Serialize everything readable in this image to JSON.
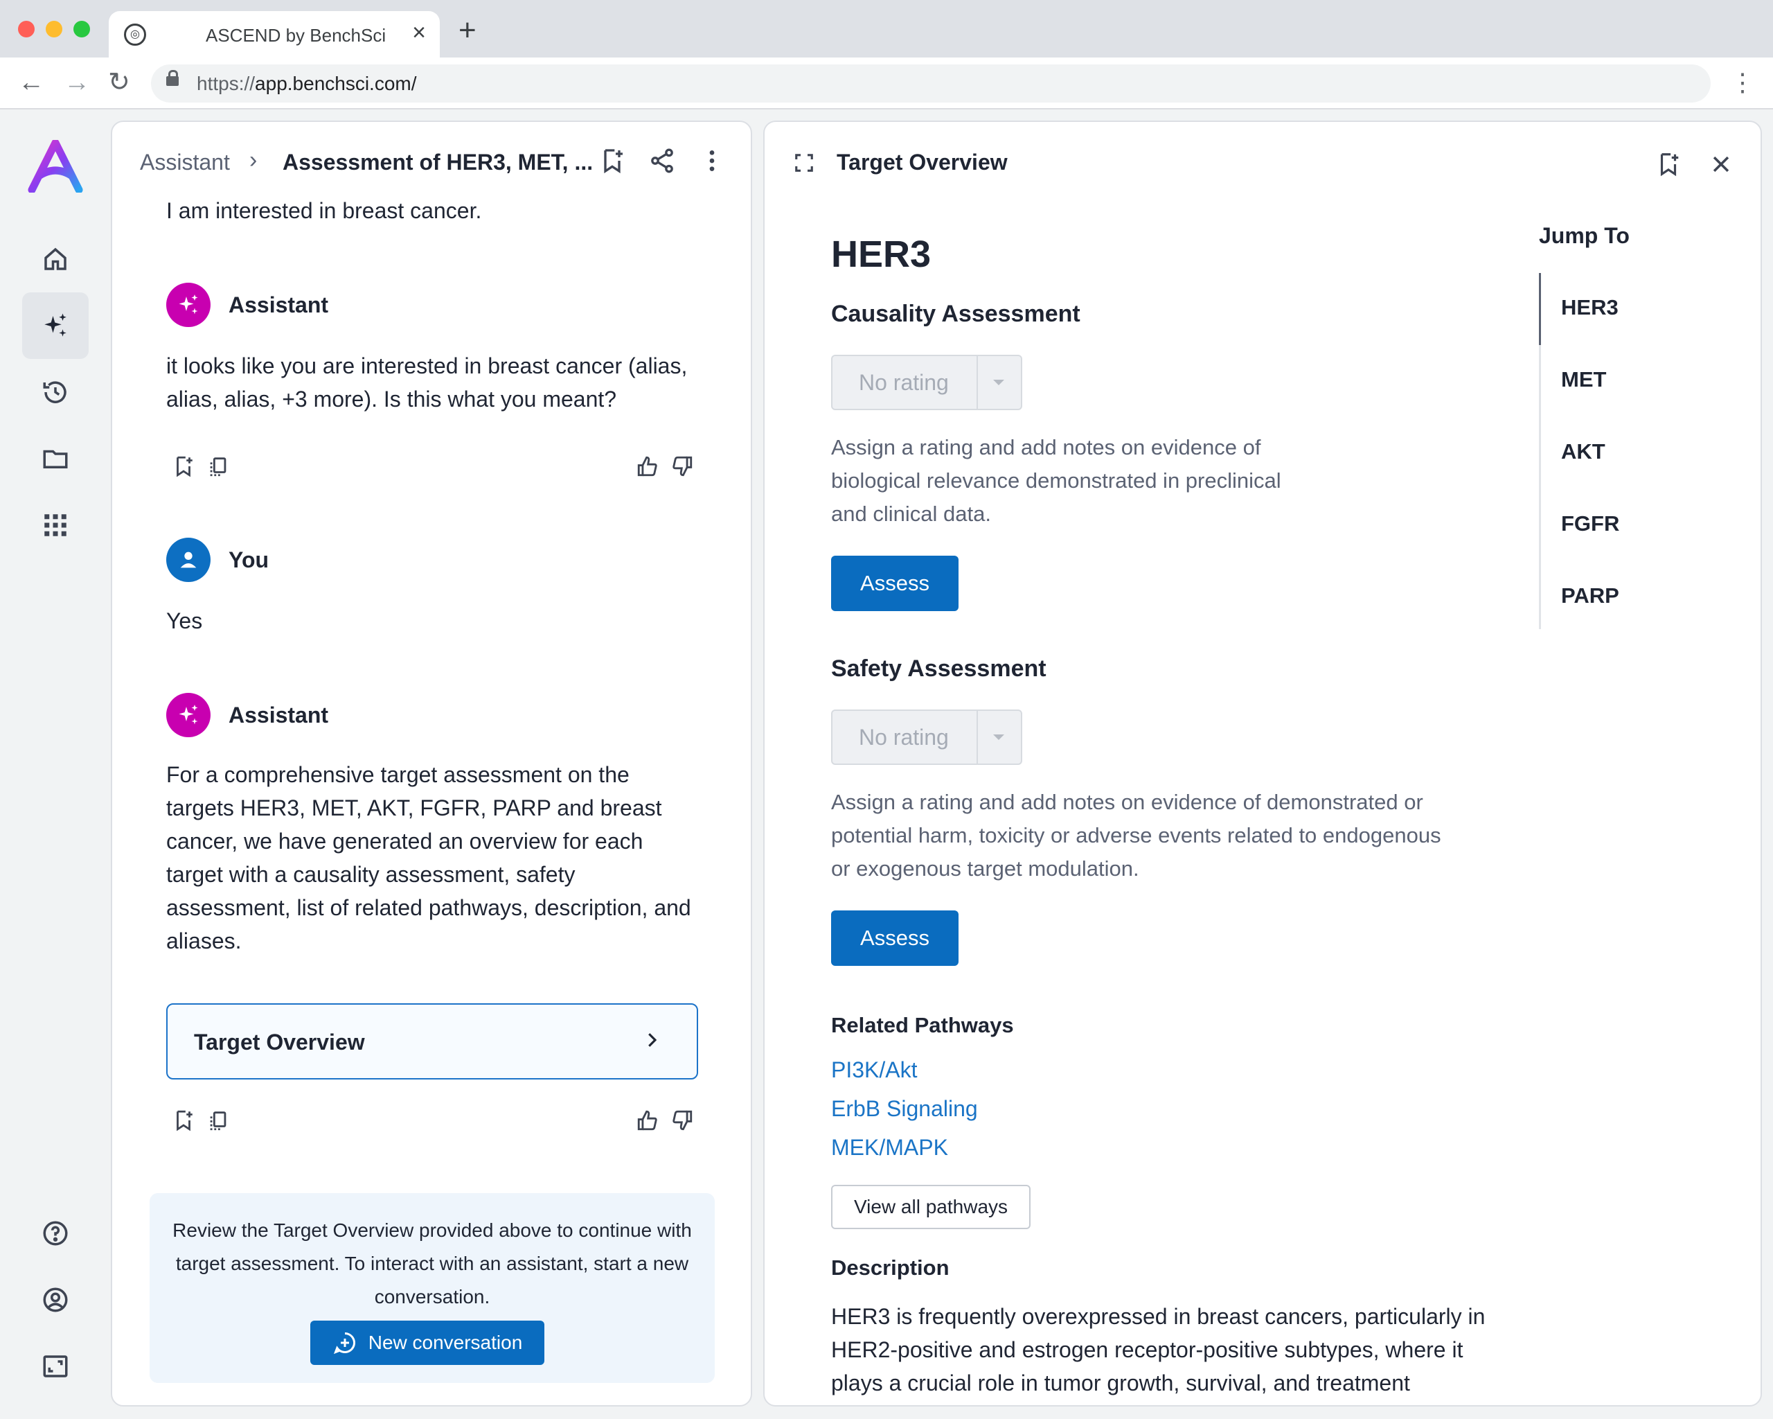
{
  "browser": {
    "tab_title": "ASCEND by BenchSci",
    "url_scheme": "https://",
    "url_rest": "app.benchsci.com/"
  },
  "sidebar": {
    "items": [
      {
        "name": "home-icon"
      },
      {
        "name": "sparkle-icon",
        "active": true
      },
      {
        "name": "history-icon"
      },
      {
        "name": "folder-icon"
      },
      {
        "name": "apps-grid-icon"
      }
    ],
    "bottom_items": [
      {
        "name": "help-icon"
      },
      {
        "name": "account-icon"
      },
      {
        "name": "expand-window-icon"
      }
    ]
  },
  "chat": {
    "breadcrumb": {
      "root": "Assistant",
      "separator": "›",
      "current": "Assessment of HER3, MET, ..."
    },
    "messages": [
      {
        "sender": "",
        "text": "I am interested in breast cancer."
      },
      {
        "sender": "Assistant",
        "text": "it looks like you are interested in breast cancer (alias, alias, alias, +3 more). Is this what you meant?"
      },
      {
        "sender": "You",
        "text": "Yes"
      },
      {
        "sender": "Assistant",
        "text": "For a comprehensive target assessment on the targets HER3, MET, AKT, FGFR, PARP and breast cancer, we have generated an overview for each target with a causality assessment, safety assessment, list of related pathways, description, and aliases."
      }
    ],
    "target_card_label": "Target Overview",
    "notice": {
      "text": "Review the Target Overview provided above to continue with target assessment. To interact with an assistant, start a new conversation.",
      "button_label": "New conversation"
    }
  },
  "overview": {
    "panel_title": "Target Overview",
    "target": "HER3",
    "causality": {
      "heading": "Causality Assessment",
      "rating": "No rating",
      "description": "Assign a rating and add notes on evidence of biological relevance demonstrated in preclinical and clinical data.",
      "button_label": "Assess"
    },
    "safety": {
      "heading": "Safety Assessment",
      "rating": "No rating",
      "description": "Assign a rating and add notes on evidence of demonstrated or potential harm, toxicity or adverse events related to endogenous or exogenous target modulation.",
      "button_label": "Assess"
    },
    "pathways": {
      "heading": "Related Pathways",
      "items": [
        "PI3K/Akt",
        "ErbB Signaling",
        "MEK/MAPK"
      ],
      "view_all_label": "View all pathways"
    },
    "description": {
      "heading": "Description",
      "text": "HER3 is frequently overexpressed in breast cancers, particularly in HER2-positive and estrogen receptor-positive subtypes, where it plays a crucial role in tumor growth, survival, and treatment resistance."
    },
    "jump_to": {
      "title": "Jump To",
      "items": [
        "HER3",
        "MET",
        "AKT",
        "FGFR",
        "PARP"
      ],
      "active": "HER3"
    }
  },
  "colors": {
    "primary": "#0a6cbf",
    "link": "#1a74c6",
    "assistant_avatar": "#c800b0",
    "user_avatar": "#0d6fc2"
  }
}
